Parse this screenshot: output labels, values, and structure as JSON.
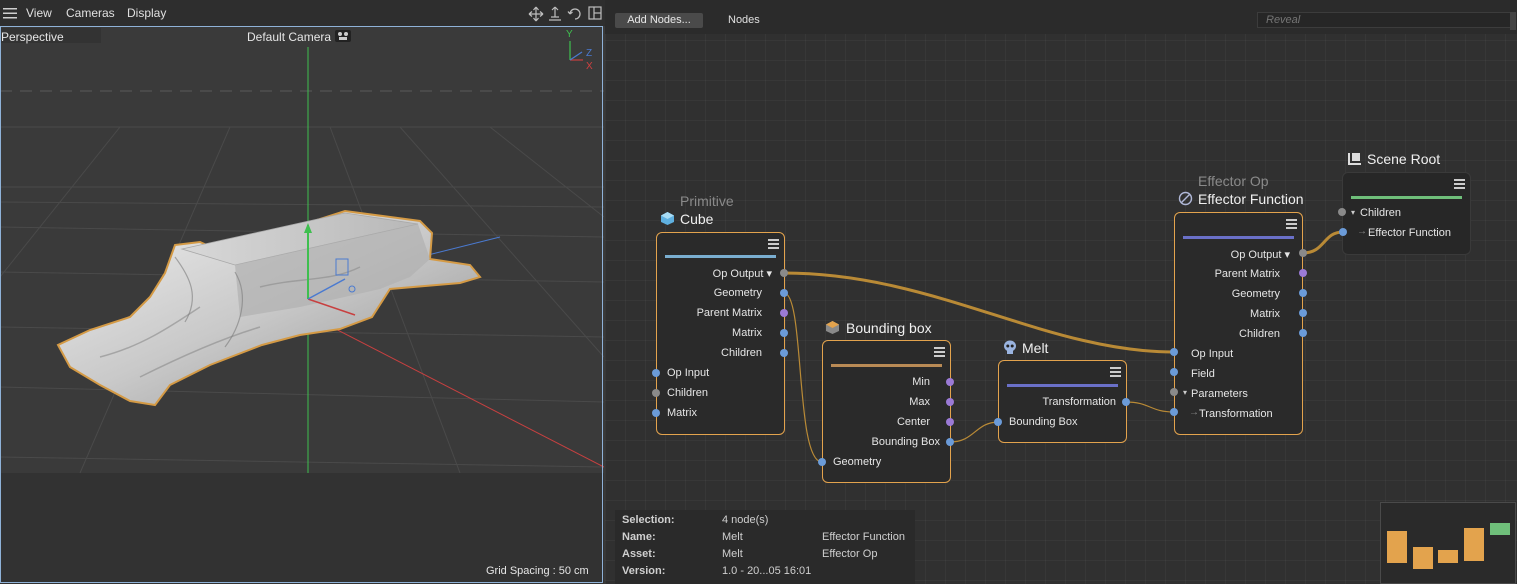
{
  "viewport": {
    "menu": [
      "View",
      "Cameras",
      "Display"
    ],
    "projection": "Perspective",
    "camera": "Default Camera",
    "grid_spacing": "Grid Spacing : 50 cm",
    "axes": {
      "y": "Y",
      "z": "Z",
      "x": "X"
    }
  },
  "editor": {
    "add_nodes": "Add Nodes...",
    "nodes_menu": "Nodes",
    "reveal_placeholder": "Reveal",
    "nodes": {
      "cube": {
        "category": "Primitive",
        "title": "Cube",
        "outputs": [
          "Op Output",
          "Geometry",
          "Parent Matrix",
          "Matrix",
          "Children"
        ],
        "inputs": [
          "Op Input",
          "Children",
          "Matrix"
        ]
      },
      "bbox": {
        "title": "Bounding box",
        "outputs": [
          "Min",
          "Max",
          "Center",
          "Bounding Box"
        ],
        "inputs": [
          "Geometry"
        ]
      },
      "melt": {
        "title": "Melt",
        "outputs": [
          "Transformation"
        ],
        "inputs": [
          "Bounding Box"
        ]
      },
      "effector": {
        "category": "Effector Op",
        "title": "Effector Function",
        "outputs": [
          "Op Output",
          "Parent Matrix",
          "Geometry",
          "Matrix",
          "Children"
        ],
        "inputs": [
          "Op Input",
          "Field",
          "Parameters",
          "Transformation"
        ]
      },
      "root": {
        "title": "Scene Root",
        "inputs": [
          "Children",
          "Effector Function"
        ]
      }
    },
    "info": {
      "selection_key": "Selection:",
      "selection_val": "4 node(s)",
      "name_key": "Name:",
      "name_val": "Melt",
      "name_val2": "Effector Function",
      "asset_key": "Asset:",
      "asset_val": "Melt",
      "asset_val2": "Effector Op",
      "version_key": "Version:",
      "version_val": "1.0 - 20...05 16:01"
    },
    "colors": {
      "accent": "#e3a34d",
      "wire": "#b98a36",
      "port_blue": "#6b9bd8",
      "port_purple": "#9b7ad6",
      "port_gray": "#8a8a8a"
    }
  }
}
